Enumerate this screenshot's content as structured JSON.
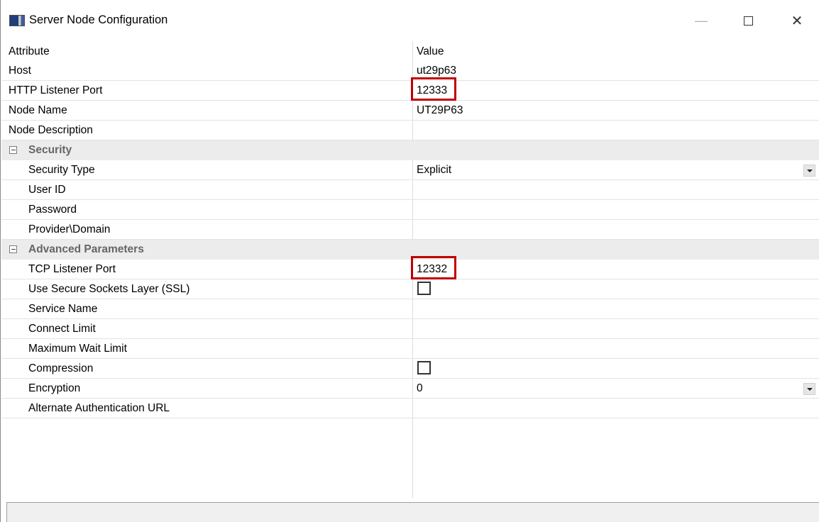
{
  "window": {
    "title": "Server Node Configuration",
    "minimize_glyph": "—",
    "close_glyph": "✕"
  },
  "grid": {
    "headers": {
      "attribute": "Attribute",
      "value": "Value"
    },
    "rows": [
      {
        "name": "Host",
        "value": "ut29p63"
      },
      {
        "name": "HTTP Listener Port",
        "value": "12333"
      },
      {
        "name": "Node Name",
        "value": "UT29P63"
      },
      {
        "name": "Node Description",
        "value": ""
      }
    ],
    "security": {
      "category": "Security",
      "rows": [
        {
          "name": "Security Type",
          "value": "Explicit"
        },
        {
          "name": "User ID",
          "value": ""
        },
        {
          "name": "Password",
          "value": ""
        },
        {
          "name": "Provider\\Domain",
          "value": ""
        }
      ]
    },
    "advanced": {
      "category": "Advanced Parameters",
      "rows": [
        {
          "name": "TCP Listener Port",
          "value": "12332"
        },
        {
          "name": "Use Secure Sockets Layer (SSL)",
          "checked": false
        },
        {
          "name": "Service Name",
          "value": ""
        },
        {
          "name": "Connect Limit",
          "value": ""
        },
        {
          "name": "Maximum Wait Limit",
          "value": ""
        },
        {
          "name": "Compression",
          "checked": false
        },
        {
          "name": "Encryption",
          "value": "0"
        },
        {
          "name": "Alternate Authentication URL",
          "value": ""
        }
      ]
    }
  },
  "highlight_color": "#c00000",
  "icons": {
    "app": "app-window-icon",
    "collapse": "collapse-minus-icon",
    "dropdown": "dropdown-arrow-icon"
  }
}
